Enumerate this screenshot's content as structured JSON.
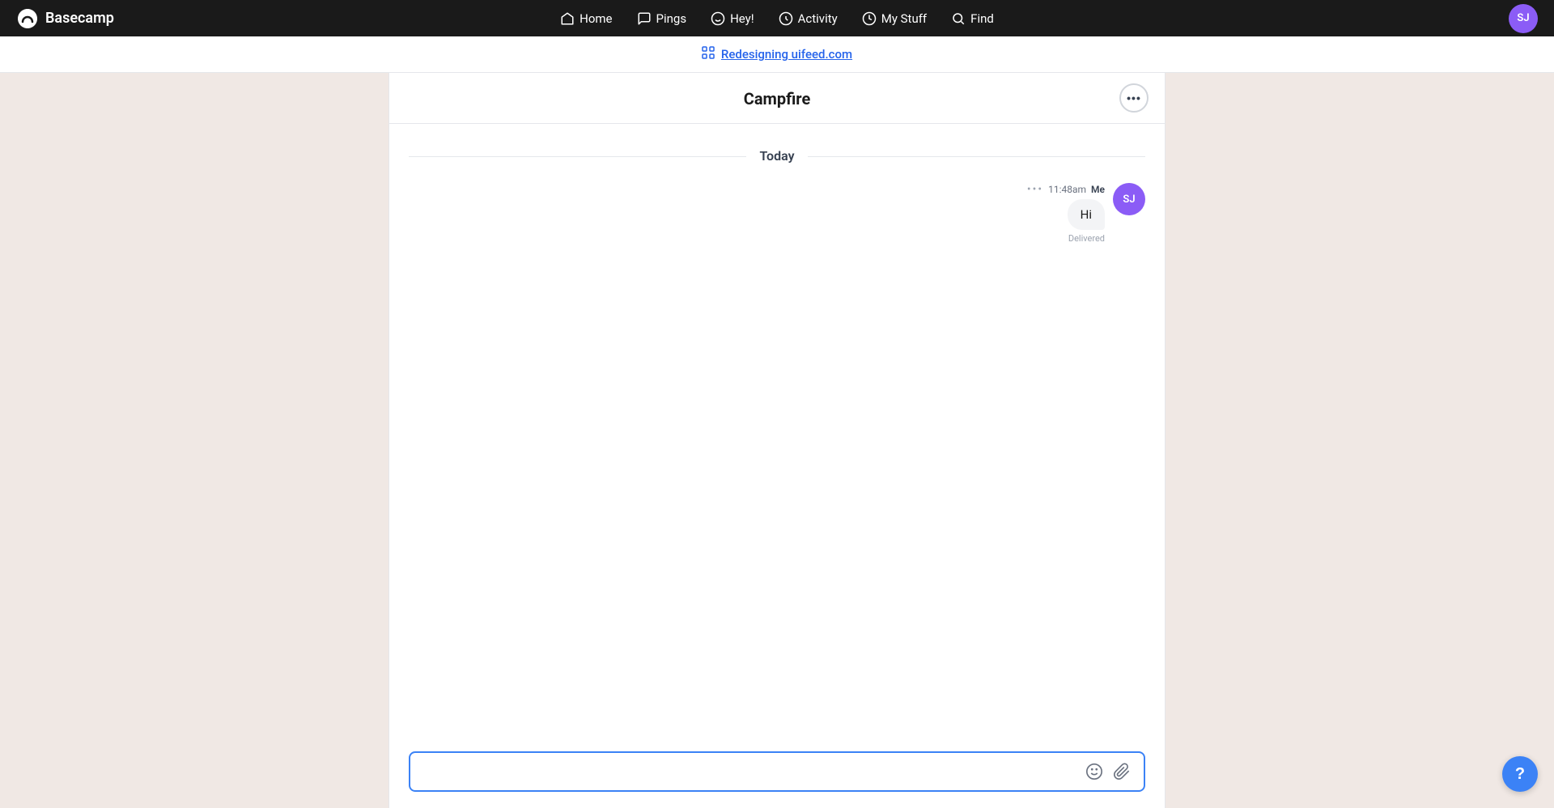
{
  "nav": {
    "logo_text": "Basecamp",
    "items": [
      {
        "id": "home",
        "label": "Home",
        "icon": "home-icon"
      },
      {
        "id": "pings",
        "label": "Pings",
        "icon": "pings-icon"
      },
      {
        "id": "hey",
        "label": "Hey!",
        "icon": "hey-icon"
      },
      {
        "id": "activity",
        "label": "Activity",
        "icon": "activity-icon"
      },
      {
        "id": "my-stuff",
        "label": "My Stuff",
        "icon": "my-stuff-icon"
      },
      {
        "id": "find",
        "label": "Find",
        "icon": "find-icon"
      }
    ],
    "avatar_initials": "SJ",
    "avatar_bg": "#8b5cf6"
  },
  "project_bar": {
    "project_name": "Redesigning uifeed.com",
    "project_icon": "grid-icon"
  },
  "chat": {
    "title": "Campfire",
    "options_icon": "ellipsis-icon",
    "date_label": "Today",
    "messages": [
      {
        "id": "msg-1",
        "dots": "•••",
        "time": "11:48am",
        "sender": "Me",
        "text": "Hi",
        "status": "Delivered",
        "avatar_initials": "SJ",
        "avatar_bg": "#8b5cf6",
        "align": "right"
      }
    ]
  },
  "input": {
    "placeholder": "",
    "emoji_icon": "emoji-icon",
    "attach_icon": "attach-icon"
  },
  "help": {
    "label": "?"
  }
}
